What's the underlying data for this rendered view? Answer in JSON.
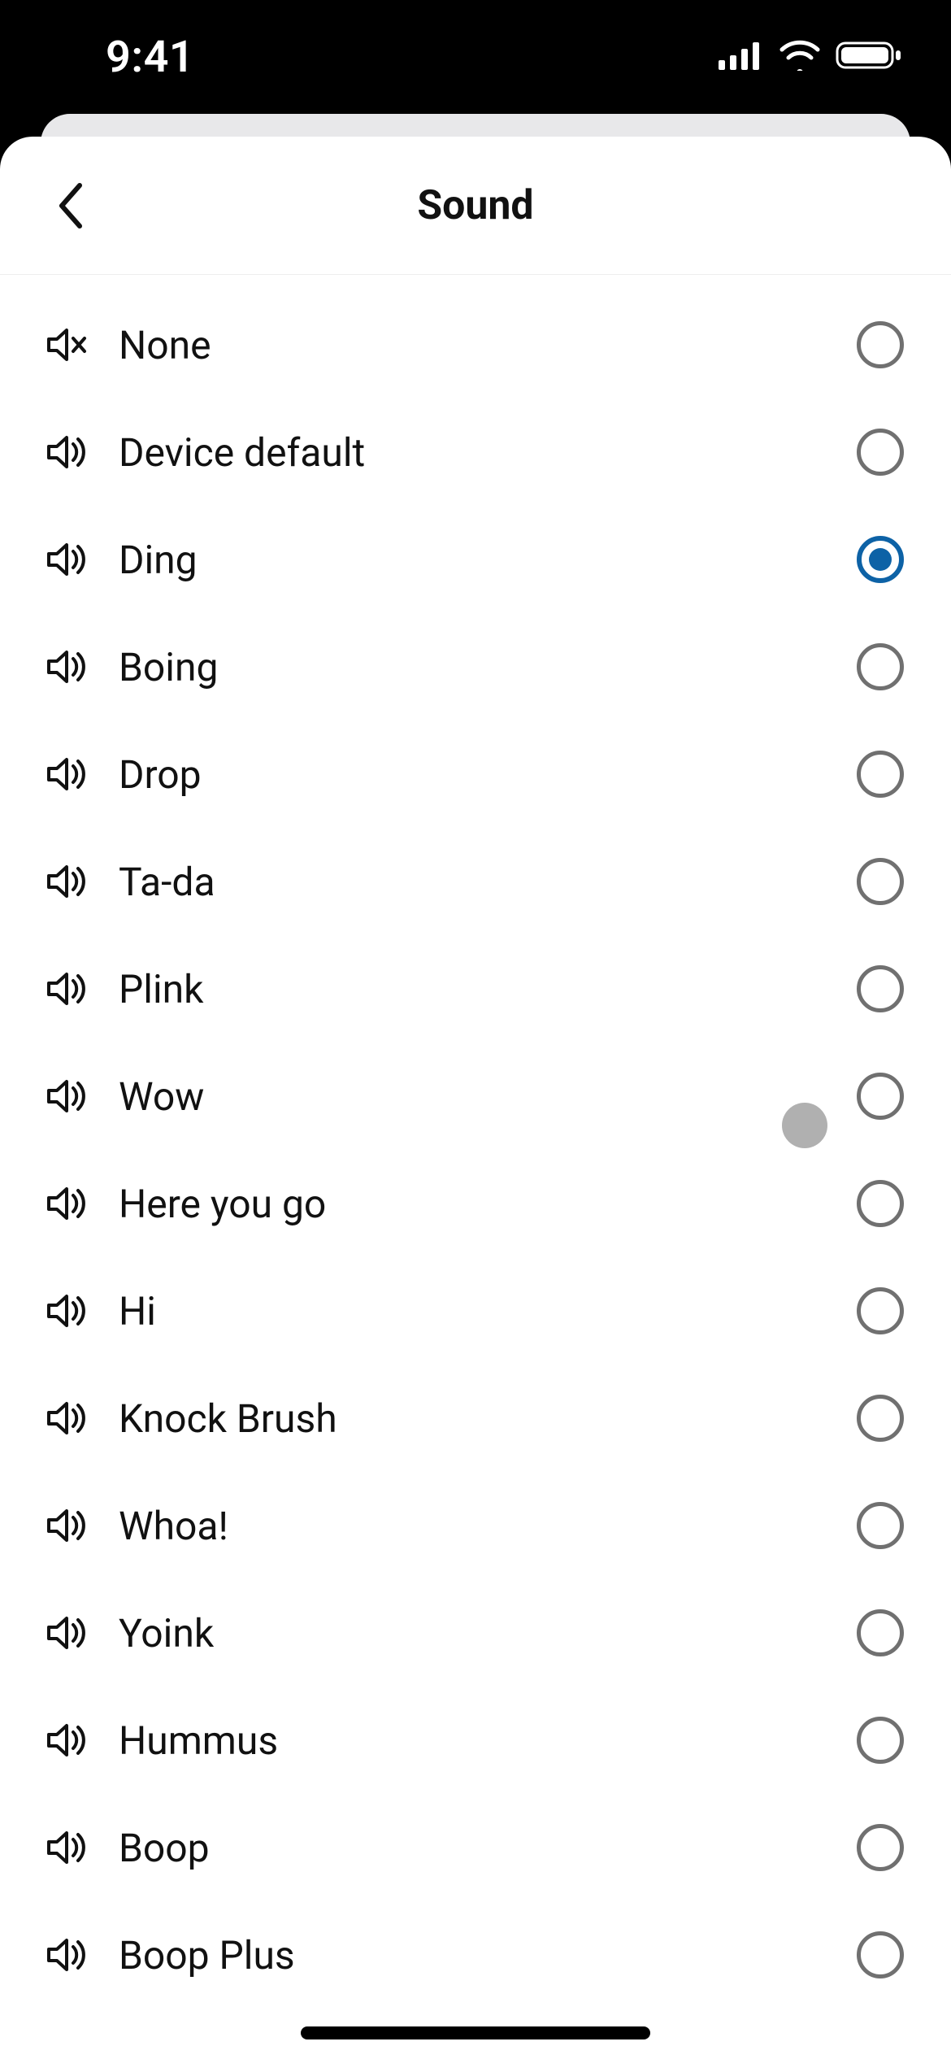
{
  "status": {
    "time": "9:41"
  },
  "header": {
    "title": "Sound"
  },
  "sounds": {
    "items": [
      {
        "label": "None",
        "muted": true,
        "selected": false
      },
      {
        "label": "Device default",
        "muted": false,
        "selected": false
      },
      {
        "label": "Ding",
        "muted": false,
        "selected": true
      },
      {
        "label": "Boing",
        "muted": false,
        "selected": false
      },
      {
        "label": "Drop",
        "muted": false,
        "selected": false
      },
      {
        "label": "Ta-da",
        "muted": false,
        "selected": false
      },
      {
        "label": "Plink",
        "muted": false,
        "selected": false
      },
      {
        "label": "Wow",
        "muted": false,
        "selected": false
      },
      {
        "label": "Here you go",
        "muted": false,
        "selected": false
      },
      {
        "label": "Hi",
        "muted": false,
        "selected": false
      },
      {
        "label": "Knock Brush",
        "muted": false,
        "selected": false
      },
      {
        "label": "Whoa!",
        "muted": false,
        "selected": false
      },
      {
        "label": "Yoink",
        "muted": false,
        "selected": false
      },
      {
        "label": "Hummus",
        "muted": false,
        "selected": false
      },
      {
        "label": "Boop",
        "muted": false,
        "selected": false
      },
      {
        "label": "Boop Plus",
        "muted": false,
        "selected": false
      }
    ]
  }
}
